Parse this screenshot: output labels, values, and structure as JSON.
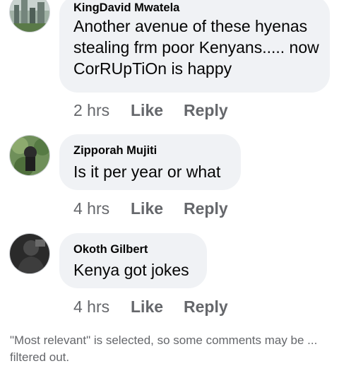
{
  "comments": [
    {
      "author": "KingDavid Mwatela",
      "text": "Another avenue of these hyenas stealing frm poor Kenyans..... now CorRUpTiOn is happy",
      "time": "2 hrs",
      "like_label": "Like",
      "reply_label": "Reply"
    },
    {
      "author": "Zipporah Mujiti",
      "text": "Is it per year or what",
      "time": "4 hrs",
      "like_label": "Like",
      "reply_label": "Reply"
    },
    {
      "author": "Okoth Gilbert",
      "text": "Kenya got jokes",
      "time": "4 hrs",
      "like_label": "Like",
      "reply_label": "Reply"
    }
  ],
  "footer_notice": "\"Most relevant\" is selected, so some comments may be ... filtered out."
}
